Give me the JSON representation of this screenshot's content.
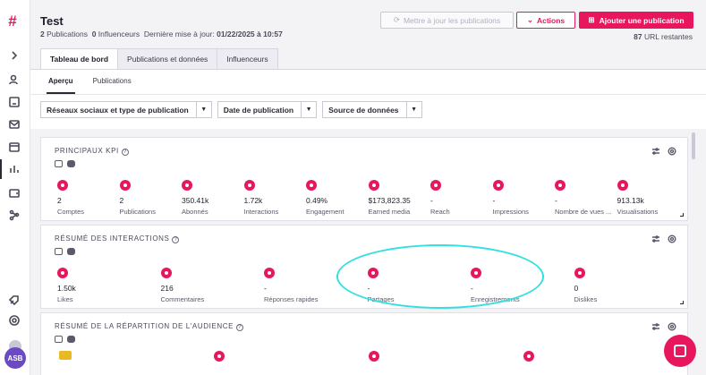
{
  "brand": {
    "accent": "#e8175d",
    "logo_icon": "hashtag-logo-icon"
  },
  "rail": {
    "icons": [
      "chevron-right-icon",
      "user-search-icon",
      "contact-card-icon",
      "mail-icon",
      "calendar-icon",
      "bar-chart-icon",
      "wallet-icon",
      "share-network-icon",
      "rocket-icon",
      "gear-icon"
    ],
    "avatar_initials": "ASB"
  },
  "header": {
    "title": "Test",
    "publications_count": "2",
    "publications_label": "Publications",
    "influencers_count": "0",
    "influencers_label": "Influenceurs",
    "last_update_label": "Dernière mise à jour:",
    "last_update_value": "01/22/2025 à 10:57",
    "update_button": "Mettre à jour les publications",
    "actions_button": "Actions",
    "add_button": "Ajouter une publication",
    "remaining_count": "87",
    "remaining_label": "URL restantes"
  },
  "tabs": [
    "Tableau de bord",
    "Publications et données",
    "Influenceurs"
  ],
  "subtabs": [
    "Aperçu",
    "Publications"
  ],
  "filters": [
    "Réseaux sociaux et type de publication",
    "Date de publication",
    "Source de données"
  ],
  "kpi_panel": {
    "title": "PRINCIPAUX KPI",
    "items": [
      {
        "value": "2",
        "label": "Comptes",
        "icon": "user-circle-icon"
      },
      {
        "value": "2",
        "label": "Publications",
        "icon": "document-icon"
      },
      {
        "value": "350.41k",
        "label": "Abonnés",
        "icon": "users-icon"
      },
      {
        "value": "1.72k",
        "label": "Interactions",
        "icon": "hand-pointer-icon"
      },
      {
        "value": "0.49%",
        "label": "Engagement",
        "icon": "target-icon"
      },
      {
        "value": "$173,823.35",
        "label": "Earned media",
        "icon": "dollar-icon"
      },
      {
        "value": "-",
        "label": "Reach",
        "icon": "expand-icon"
      },
      {
        "value": "-",
        "label": "Impressions",
        "icon": "eye-icon"
      },
      {
        "value": "-",
        "label": "Nombre de vues ...",
        "icon": "play-icon"
      },
      {
        "value": "913.13k",
        "label": "Visualisations",
        "icon": "play-icon"
      }
    ]
  },
  "interactions_panel": {
    "title": "RÉSUMÉ DES INTERACTIONS",
    "items": [
      {
        "value": "1.50k",
        "label": "Likes",
        "icon": "heart-icon"
      },
      {
        "value": "216",
        "label": "Commentaires",
        "icon": "comment-icon"
      },
      {
        "value": "-",
        "label": "Réponses rapides",
        "icon": "reply-icon"
      },
      {
        "value": "-",
        "label": "Partages",
        "icon": "share-icon"
      },
      {
        "value": "-",
        "label": "Enregistrements",
        "icon": "bookmark-icon"
      },
      {
        "value": "0",
        "label": "Dislikes",
        "icon": "thumbs-down-icon"
      }
    ]
  },
  "audience_panel": {
    "title": "RÉSUMÉ DE LA RÉPARTITION DE L'AUDIENCE",
    "icons": [
      "spain-flag-icon",
      "location-pin-icon",
      "location-pin-icon",
      "target-icon"
    ]
  },
  "help": {
    "icon": "chat-help-icon"
  }
}
